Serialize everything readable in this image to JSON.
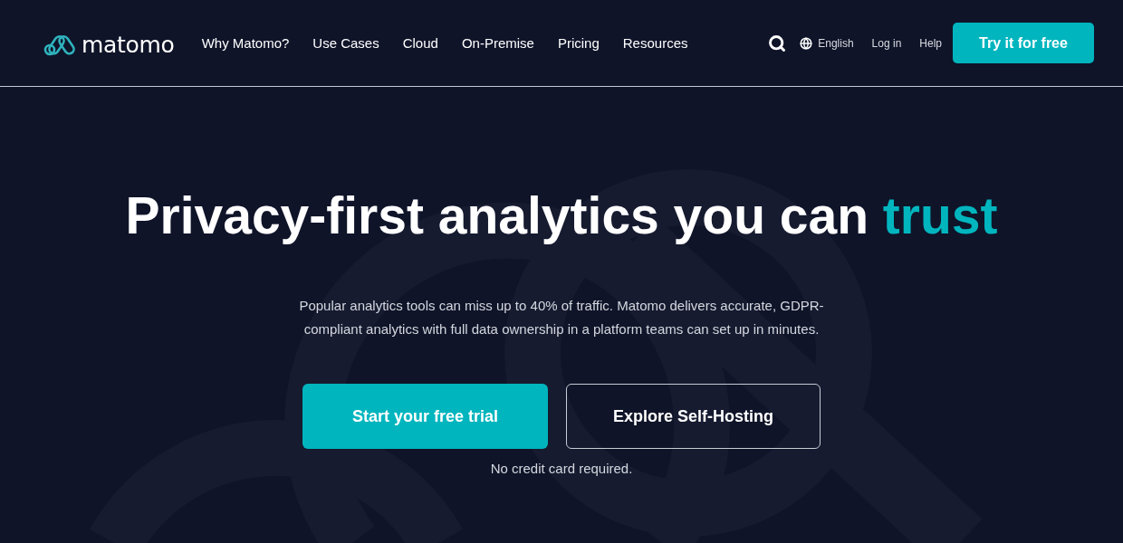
{
  "header": {
    "logo": {
      "text": "matomo"
    },
    "nav": [
      {
        "label": "Why Matomo?"
      },
      {
        "label": "Use Cases"
      },
      {
        "label": "Cloud"
      },
      {
        "label": "On-Premise"
      },
      {
        "label": "Pricing"
      },
      {
        "label": "Resources"
      }
    ],
    "language": {
      "label": "English"
    },
    "links": [
      {
        "label": "Log in"
      },
      {
        "label": "Help"
      }
    ],
    "cta": {
      "label": "Try it for free"
    }
  },
  "hero": {
    "headline": [
      {
        "text": "Privacy-first analytics you can ",
        "accent": false
      },
      {
        "text": "trust",
        "accent": true
      }
    ],
    "description": "Popular analytics tools can miss up to 40% of traffic. Matomo delivers accurate, GDPR-compliant analytics with full data ownership in a platform teams can set up in minutes.",
    "buttons": [
      {
        "label": "Start your free trial",
        "kind": "primary"
      },
      {
        "label": "Explore Self-Hosting",
        "kind": "outline"
      }
    ],
    "note": "No credit card required."
  }
}
